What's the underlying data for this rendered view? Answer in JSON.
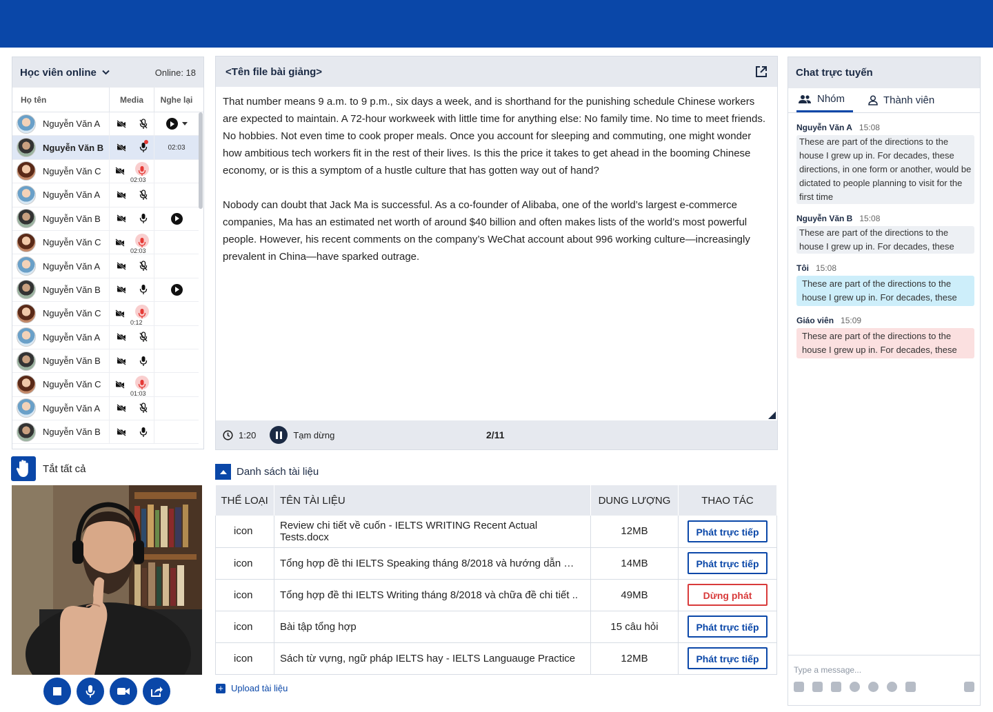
{
  "left_panel": {
    "title": "Học viên online",
    "online_count": "Online: 18",
    "columns": {
      "name": "Họ tên",
      "media": "Media",
      "replay": "Nghe lại"
    },
    "students": [
      {
        "name": "Nguyễn Văn A",
        "avatar": "a",
        "mic": "muted",
        "replay": "play-menu"
      },
      {
        "name": "Nguyễn Văn B",
        "avatar": "b",
        "mic": "recording",
        "replay_time": "02:03",
        "active": true
      },
      {
        "name": "Nguyễn Văn C",
        "avatar": "c",
        "mic": "live",
        "mic_time": "02:03"
      },
      {
        "name": "Nguyễn Văn A",
        "avatar": "a",
        "mic": "muted"
      },
      {
        "name": "Nguyễn Văn B",
        "avatar": "b",
        "mic": "on",
        "replay": "play"
      },
      {
        "name": "Nguyễn Văn C",
        "avatar": "c",
        "mic": "live",
        "mic_time": "02:03"
      },
      {
        "name": "Nguyễn Văn A",
        "avatar": "a",
        "mic": "muted"
      },
      {
        "name": "Nguyễn Văn B",
        "avatar": "b",
        "mic": "on",
        "replay": "play"
      },
      {
        "name": "Nguyễn Văn C",
        "avatar": "c",
        "mic": "live",
        "mic_time": "0:12"
      },
      {
        "name": "Nguyễn Văn A",
        "avatar": "a",
        "mic": "muted"
      },
      {
        "name": "Nguyễn Văn B",
        "avatar": "b",
        "mic": "on"
      },
      {
        "name": "Nguyễn Văn C",
        "avatar": "c",
        "mic": "live",
        "mic_time": "01:03"
      },
      {
        "name": "Nguyễn Văn A",
        "avatar": "a",
        "mic": "muted"
      },
      {
        "name": "Nguyễn Văn B",
        "avatar": "b",
        "mic": "on"
      }
    ]
  },
  "raise_all_label": "Tắt tất cả",
  "doc": {
    "title": "<Tên file bài giảng>",
    "paragraphs": [
      "That number means 9 a.m. to 9 p.m., six days a week, and is shorthand for the punishing schedule Chinese workers are expected to maintain. A 72-hour workweek with little time for anything else: No family time. No time to meet friends. No hobbies. Not even time to cook proper meals. Once you account for sleeping and commuting, one might wonder how ambitious tech workers fit in the rest of their lives. Is this the price it takes to get ahead in the booming Chinese economy, or is this a symptom of a hustle culture that has gotten way out of hand?",
      "Nobody can doubt that Jack Ma is successful. As a co-founder of Alibaba, one of the world’s largest e-commerce companies, Ma has an estimated net worth of around $40 billion and often makes lists of the world’s most powerful people. However, his recent comments on the company’s WeChat account about 996 working culture—increasingly prevalent in China—have sparked outrage."
    ],
    "elapsed": "1:20",
    "pause_label": "Tạm dừng",
    "page": "2/11"
  },
  "docs": {
    "section_title": "Danh sách tài liệu",
    "headers": [
      "THỂ LOẠI",
      "TÊN TÀI LIỆU",
      "DUNG LƯỢNG",
      "THAO TÁC"
    ],
    "rows": [
      {
        "type": "icon",
        "name": "Review chi tiết về cuốn - IELTS WRITING Recent Actual Tests.docx",
        "size": "12MB",
        "action": "Phát trực tiếp"
      },
      {
        "type": "icon",
        "name": "Tổng hợp đề thi IELTS Speaking tháng 8/2018 và hướng dẫn …",
        "size": "14MB",
        "action": "Phát trực tiếp"
      },
      {
        "type": "icon",
        "name": "Tổng hợp đề thi IELTS Writing tháng 8/2018 và chữa đề chi tiết ..",
        "size": "49MB",
        "action": "Dừng phát",
        "stop": true
      },
      {
        "type": "icon",
        "name": "Bài tập tổng hợp",
        "size": "15 câu hỏi",
        "action": "Phát trực tiếp"
      },
      {
        "type": "icon",
        "name": "Sách từ vựng, ngữ pháp IELTS hay - IELTS Languauge Practice",
        "size": "12MB",
        "action": "Phát trực tiếp"
      }
    ],
    "upload_label": "Upload tài liệu"
  },
  "chat": {
    "title": "Chat trực tuyến",
    "tabs": [
      "Nhóm",
      "Thành viên"
    ],
    "messages": [
      {
        "author": "Nguyễn Văn A",
        "time": "15:08",
        "text": "These are part of the directions to the house I grew up in. For decades, these directions, in one form or another, would be dictated to people planning to visit for the first time",
        "style": "grey"
      },
      {
        "author": "Nguyễn Văn B",
        "time": "15:08",
        "text": "These are part of the directions to the house I grew up in. For decades, these",
        "style": "grey"
      },
      {
        "author": "Tôi",
        "time": "15:08",
        "text": "These are part of the directions to the house I grew up in. For decades, these",
        "style": "blue"
      },
      {
        "author": "Giáo viên",
        "time": "15:09",
        "text": "These are part of the directions to the house I grew up in. For decades, these",
        "style": "pink"
      }
    ],
    "input_placeholder": "Type a message..."
  },
  "colors": {
    "brand": "#0a47a8",
    "stop": "#d83a3a",
    "live_mic": "#e53935"
  }
}
